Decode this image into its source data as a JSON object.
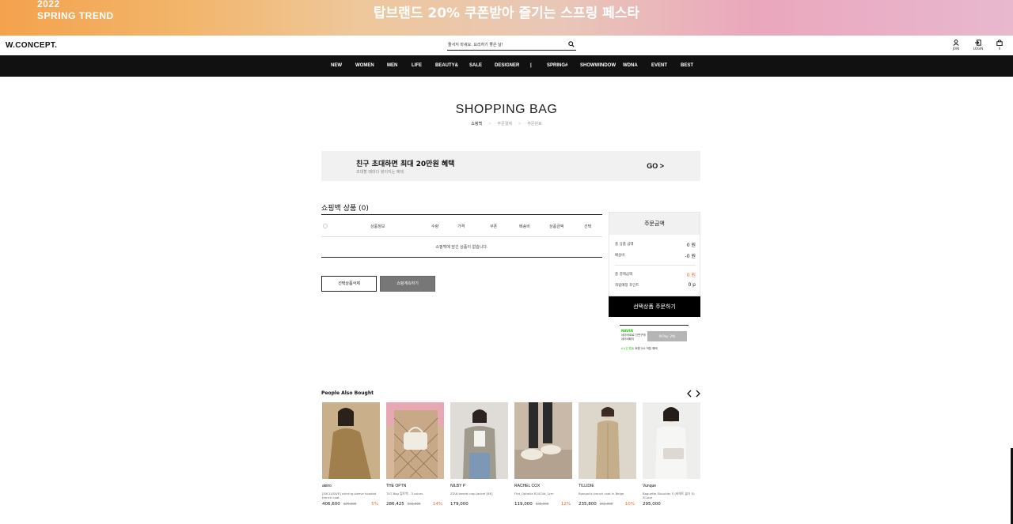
{
  "banner": {
    "year": "2022",
    "trend": "SPRING TREND",
    "headline": "탑브랜드 20% 쿠폰받아 즐기는 스프링 페스타"
  },
  "header": {
    "logo": "W.CONCEPT.",
    "search_placeholder": "줄서지 마세요. 요리하기 좋은 날!",
    "icons": [
      {
        "name": "user-icon",
        "label": "JOIN"
      },
      {
        "name": "login-icon",
        "label": "LOGIN"
      },
      {
        "name": "bag-icon",
        "label": "0"
      }
    ]
  },
  "nav": {
    "items": [
      "NEW",
      "WOMEN",
      "MEN",
      "LIFE",
      "BEAUTY&",
      "SALE",
      "DESIGNER",
      "|",
      "SPRING#",
      "SHOWWINDOW",
      "WDNA",
      "EVENT",
      "BEST"
    ]
  },
  "page": {
    "title": "SHOPPING BAG",
    "steps": [
      "쇼핑백",
      "주문결제",
      "주문완료"
    ]
  },
  "promo": {
    "title": "친구 초대하면 최대 20만원 혜택",
    "subtitle": "초대할 때마다 쌓이지는 혜택",
    "go": "GO >"
  },
  "bag": {
    "title": "쇼핑백 상품 (0)",
    "columns": [
      "상품정보",
      "수량",
      "가격",
      "쿠폰",
      "배송비",
      "상품금액",
      "선택"
    ],
    "empty_message": "쇼핑백에 담긴 상품이 없습니다.",
    "delete_button": "선택상품삭제",
    "continue_button": "쇼핑계속하기"
  },
  "summary": {
    "title": "주문금액",
    "rows": [
      {
        "label": "총 상품 금액",
        "value": "0 원"
      },
      {
        "label": "배송비",
        "value": "-0 원"
      },
      {
        "label": "총 결제금액",
        "value": "0 원"
      },
      {
        "label": "적립예정 포인트",
        "value": "0 p"
      }
    ],
    "order_button": "선택상품 주문하기",
    "accent": "#f26522"
  },
  "npay": {
    "logo": "NAVER",
    "line1": "네이버ID로 간편구매",
    "line2": "네이버페이",
    "button": "N Pay 구매",
    "foot_green": "0시간 활동",
    "foot": "회원 5% 적립 혜택"
  },
  "also_bought": {
    "title": "People Also Bought",
    "products": [
      {
        "brand": "akiiro",
        "name": "[EXCLUSIVE] shirring-sleeve hooded trench coat",
        "price": "406,600",
        "original": "429,000",
        "discount": "5%"
      },
      {
        "brand": "THE OPTN",
        "name": "TILT Bag 힐트백 - 3 colors",
        "price": "286,425",
        "original": "333,000",
        "discount": "14%"
      },
      {
        "brand": "NILBY P",
        "name": "ZZ\\N tweed crop jacket [BE]",
        "price": "179,000",
        "original": "",
        "discount": ""
      },
      {
        "brand": "RACHEL COX",
        "name": "Flat_Ophelia R2474d_1cm",
        "price": "119,000",
        "original": "135,000",
        "discount": "12%"
      },
      {
        "brand": "TILLIDIE",
        "name": "Romantic trench coat in Beige",
        "price": "235,800",
        "original": "262,000",
        "discount": "10%"
      },
      {
        "brand": "Vunque",
        "name": "Baguette Shoulder S (바게트 숄더 S) 3Color",
        "price": "295,000",
        "original": "",
        "discount": ""
      }
    ]
  }
}
